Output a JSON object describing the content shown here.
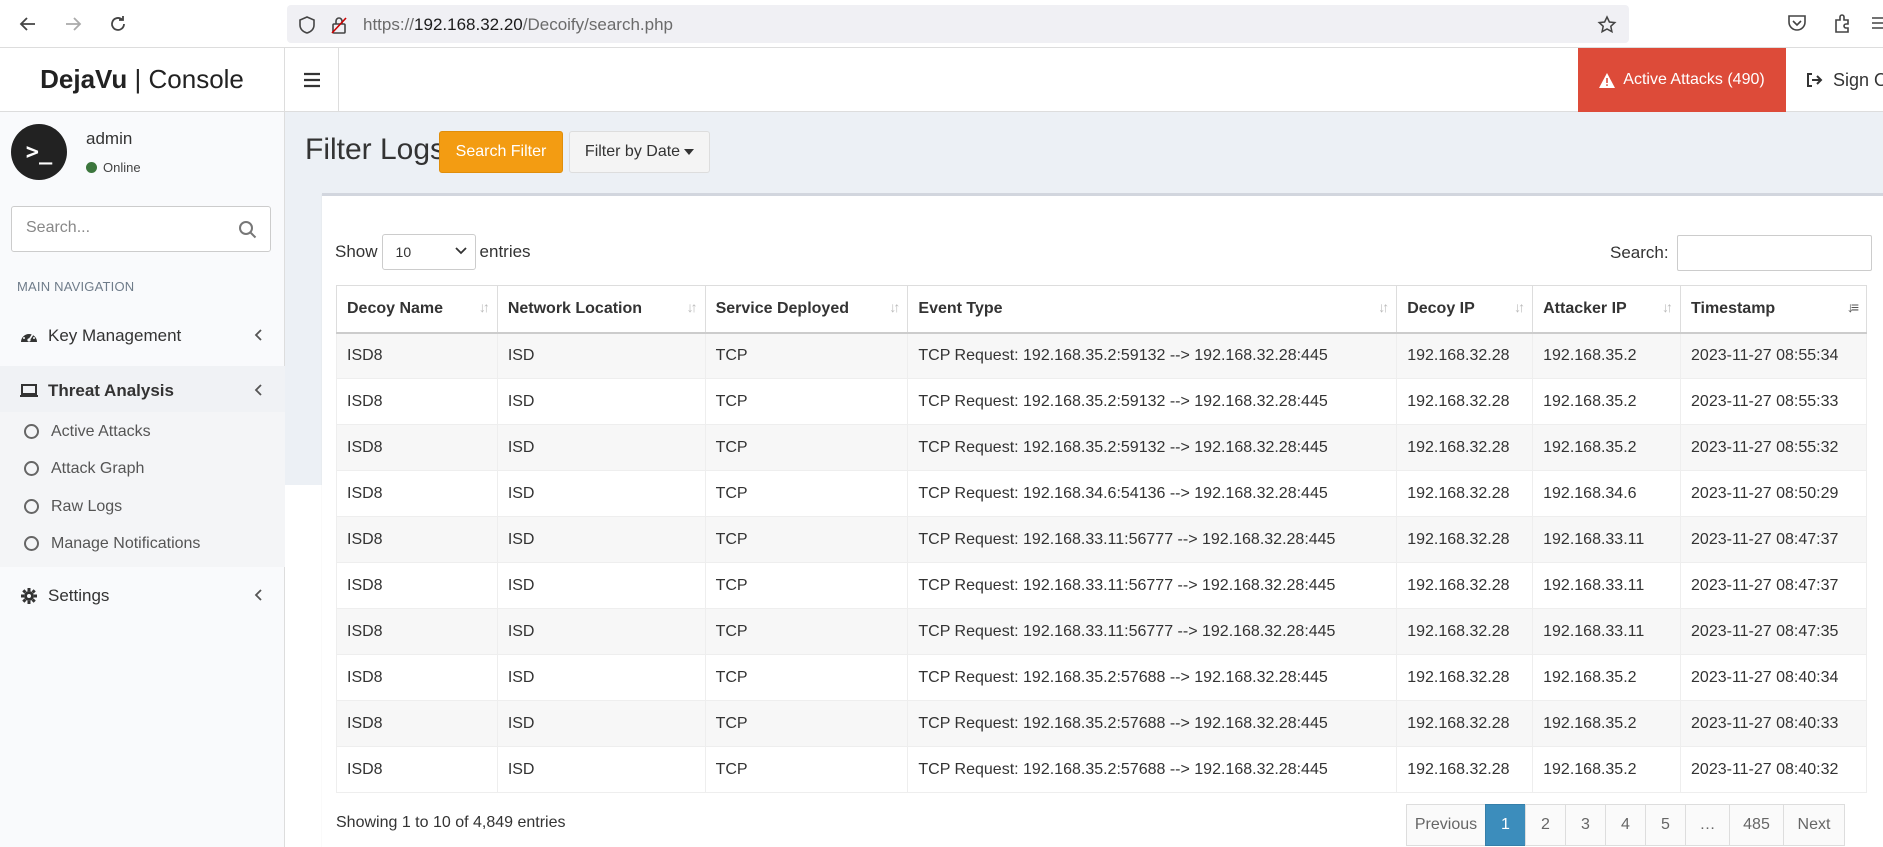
{
  "browser": {
    "url_prefix": "https://",
    "url_host": "192.168.32.20",
    "url_path": "/Decoify/search.php"
  },
  "app": {
    "brand_bold": "DejaVu",
    "brand_rest": " | Console"
  },
  "header": {
    "active_attacks_label": "Active Attacks (490)",
    "sign_out_label": "Sign O"
  },
  "user": {
    "name": "admin",
    "status": "Online",
    "avatar_text": ">_"
  },
  "sidebar": {
    "search_placeholder": "Search...",
    "nav_header": "MAIN NAVIGATION",
    "items": [
      {
        "label": "Key Management",
        "icon": "dashboard-icon"
      },
      {
        "label": "Threat Analysis",
        "icon": "laptop-icon"
      },
      {
        "label": "Settings",
        "icon": "gear-icon"
      }
    ],
    "subitems": [
      {
        "label": "Active Attacks"
      },
      {
        "label": "Attack Graph"
      },
      {
        "label": "Raw Logs"
      },
      {
        "label": "Manage Notifications"
      }
    ]
  },
  "page": {
    "title": "Filter Logs",
    "search_filter_label": "Search Filter",
    "filter_by_date_label": "Filter by Date"
  },
  "table_controls": {
    "show_label": "Show",
    "length_value": "10",
    "entries_label": "entries",
    "search_label": "Search:"
  },
  "table": {
    "columns": [
      "Decoy Name",
      "Network Location",
      "Service Deployed",
      "Event Type",
      "Decoy IP",
      "Attacker IP",
      "Timestamp"
    ],
    "rows": [
      [
        "ISD8",
        "ISD",
        "TCP",
        "TCP Request: 192.168.35.2:59132 --> 192.168.32.28:445",
        "192.168.32.28",
        "192.168.35.2",
        "2023-11-27 08:55:34"
      ],
      [
        "ISD8",
        "ISD",
        "TCP",
        "TCP Request: 192.168.35.2:59132 --> 192.168.32.28:445",
        "192.168.32.28",
        "192.168.35.2",
        "2023-11-27 08:55:33"
      ],
      [
        "ISD8",
        "ISD",
        "TCP",
        "TCP Request: 192.168.35.2:59132 --> 192.168.32.28:445",
        "192.168.32.28",
        "192.168.35.2",
        "2023-11-27 08:55:32"
      ],
      [
        "ISD8",
        "ISD",
        "TCP",
        "TCP Request: 192.168.34.6:54136 --> 192.168.32.28:445",
        "192.168.32.28",
        "192.168.34.6",
        "2023-11-27 08:50:29"
      ],
      [
        "ISD8",
        "ISD",
        "TCP",
        "TCP Request: 192.168.33.11:56777 --> 192.168.32.28:445",
        "192.168.32.28",
        "192.168.33.11",
        "2023-11-27 08:47:37"
      ],
      [
        "ISD8",
        "ISD",
        "TCP",
        "TCP Request: 192.168.33.11:56777 --> 192.168.32.28:445",
        "192.168.32.28",
        "192.168.33.11",
        "2023-11-27 08:47:37"
      ],
      [
        "ISD8",
        "ISD",
        "TCP",
        "TCP Request: 192.168.33.11:56777 --> 192.168.32.28:445",
        "192.168.32.28",
        "192.168.33.11",
        "2023-11-27 08:47:35"
      ],
      [
        "ISD8",
        "ISD",
        "TCP",
        "TCP Request: 192.168.35.2:57688 --> 192.168.32.28:445",
        "192.168.32.28",
        "192.168.35.2",
        "2023-11-27 08:40:34"
      ],
      [
        "ISD8",
        "ISD",
        "TCP",
        "TCP Request: 192.168.35.2:57688 --> 192.168.32.28:445",
        "192.168.32.28",
        "192.168.35.2",
        "2023-11-27 08:40:33"
      ],
      [
        "ISD8",
        "ISD",
        "TCP",
        "TCP Request: 192.168.35.2:57688 --> 192.168.32.28:445",
        "192.168.32.28",
        "192.168.35.2",
        "2023-11-27 08:40:32"
      ]
    ]
  },
  "footer": {
    "info": "Showing 1 to 10 of 4,849 entries",
    "pages": [
      "Previous",
      "1",
      "2",
      "3",
      "4",
      "5",
      "…",
      "485",
      "Next"
    ],
    "active_page": "1"
  },
  "colors": {
    "danger": "#dd4b39",
    "warning": "#f39c12",
    "primary": "#3c8dbc",
    "online": "#3c763d"
  }
}
